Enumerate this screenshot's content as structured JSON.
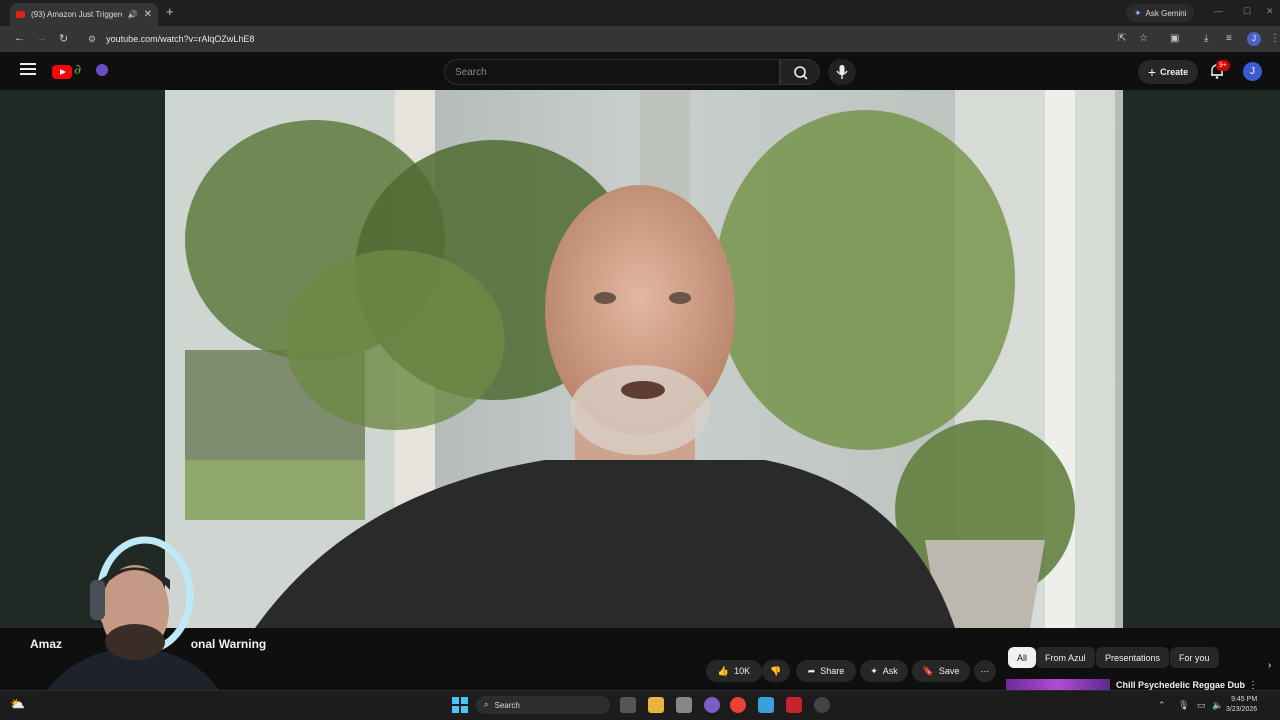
{
  "browser": {
    "tab_title": "(93) Amazon Just Triggered",
    "new_tab": "+",
    "url": "youtube.com/watch?v=rAlqOZwLhE8",
    "ask_gemini": "Ask Gemini",
    "profile_initial": "J"
  },
  "youtube": {
    "search_placeholder": "Search",
    "create_label": "Create",
    "notifications_badge": "9+",
    "avatar_initial": "J",
    "video_title_left": "Amaz",
    "video_title_right": "onal Warning",
    "actions": {
      "like_count": "10K",
      "share": "Share",
      "ask": "Ask",
      "save": "Save"
    },
    "chips": [
      "All",
      "From Azul",
      "Presentations",
      "For you"
    ],
    "recommended_title": "Chill Psychedelic Reggae Dub"
  },
  "taskbar": {
    "search": "Search",
    "time": "9:45 PM",
    "date": "3/23/2026"
  },
  "colors": {
    "youtube_red": "#ff0000",
    "page_bg": "#0f0f0f"
  }
}
